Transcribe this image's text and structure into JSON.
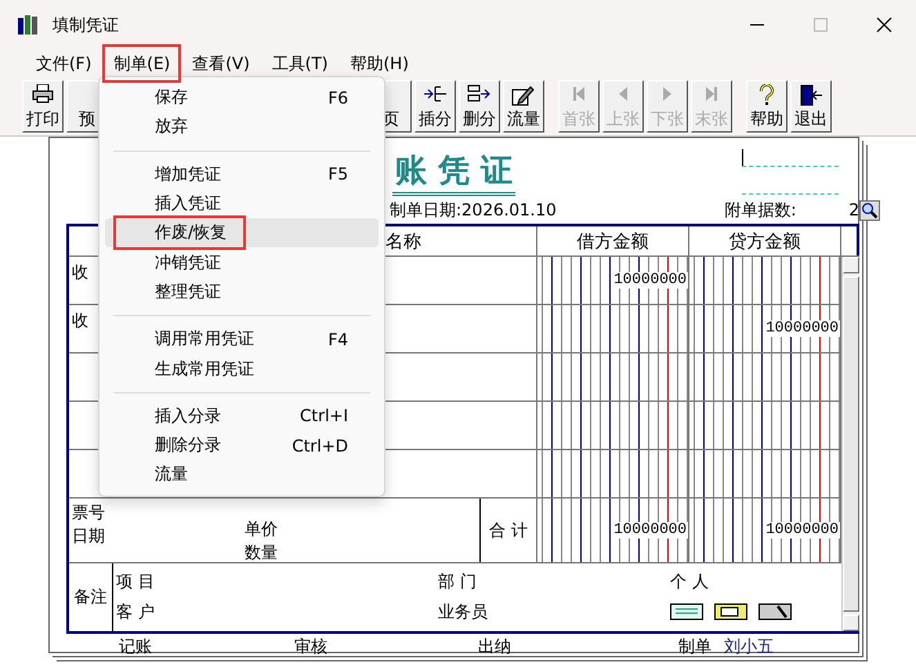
{
  "window": {
    "title": "填制凭证"
  },
  "menu_bar": [
    {
      "label": "文件(F)",
      "selected": false
    },
    {
      "label": "制单(E)",
      "selected": true
    },
    {
      "label": "查看(V)",
      "selected": false
    },
    {
      "label": "工具(T)",
      "selected": false
    },
    {
      "label": "帮助(H)",
      "selected": false
    }
  ],
  "toolbar": {
    "groups": [
      [
        {
          "label": "打印",
          "disabled": false
        },
        {
          "label": "预",
          "disabled": false
        }
      ],
      [
        {
          "label": "页",
          "disabled": false
        },
        {
          "label": "插分",
          "disabled": false
        },
        {
          "label": "删分",
          "disabled": false
        },
        {
          "label": "流量",
          "disabled": false
        }
      ],
      [
        {
          "label": "首张",
          "disabled": true
        },
        {
          "label": "上张",
          "disabled": true
        },
        {
          "label": "下张",
          "disabled": true
        },
        {
          "label": "末张",
          "disabled": true
        }
      ],
      [
        {
          "label": "帮助",
          "disabled": false
        },
        {
          "label": "退出",
          "disabled": false
        }
      ]
    ]
  },
  "dropdown_menu": {
    "items": [
      {
        "kind": "item",
        "label": "保存",
        "shortcut": "F6",
        "selected": false
      },
      {
        "kind": "item",
        "label": "放弃",
        "selected": false
      },
      {
        "kind": "separator"
      },
      {
        "kind": "item",
        "label": "增加凭证",
        "shortcut": "F5",
        "selected": false
      },
      {
        "kind": "item",
        "label": "插入凭证",
        "selected": false
      },
      {
        "kind": "item",
        "label": "作废/恢复",
        "selected": true
      },
      {
        "kind": "item",
        "label": "冲销凭证",
        "selected": false
      },
      {
        "kind": "item",
        "label": "整理凭证",
        "selected": false
      },
      {
        "kind": "separator"
      },
      {
        "kind": "item",
        "label": "调用常用凭证",
        "shortcut": "F4",
        "selected": false
      },
      {
        "kind": "item",
        "label": "生成常用凭证",
        "selected": false
      },
      {
        "kind": "separator"
      },
      {
        "kind": "item",
        "label": "插入分录",
        "shortcut": "Ctrl+I",
        "selected": false
      },
      {
        "kind": "item",
        "label": "删除分录",
        "shortcut": "Ctrl+D",
        "selected": false
      },
      {
        "kind": "item",
        "label": "流量",
        "selected": false
      }
    ]
  },
  "voucher": {
    "title": "账 凭 证",
    "date_label": "制单日期:",
    "date": "2026.01.10",
    "attachments_label": "附单据数:",
    "attachments": "2",
    "columns": [
      "名称",
      "借方金额",
      "贷方金额"
    ],
    "rows": [
      {
        "summary": "收",
        "debit": "10000000"
      },
      {
        "summary": "收",
        "credit": "10000000"
      }
    ],
    "totals": {
      "ticket_label": "票号",
      "date_label": "日期",
      "unit_price_label": "单价",
      "quantity_label": "数量",
      "total_label": "合 计",
      "debit": "10000000",
      "credit": "10000000"
    },
    "notes": {
      "label": "备注",
      "project_label": "项 目",
      "customer_label": "客 户",
      "department_label": "部 门",
      "salesperson_label": "业务员",
      "person_label": "个 人"
    },
    "signatures": [
      {
        "label": "记账"
      },
      {
        "label": "审核"
      },
      {
        "label": "出纳"
      },
      {
        "label": "制单",
        "value": "刘小五"
      }
    ]
  }
}
